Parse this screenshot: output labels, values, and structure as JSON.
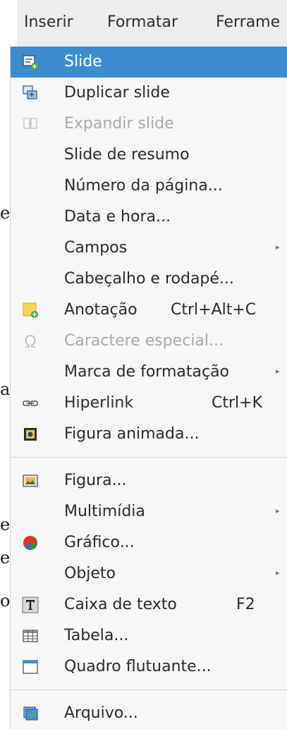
{
  "background_doc": {
    "chars": [
      "e",
      "a",
      "e",
      "e",
      "o"
    ]
  },
  "menubar": {
    "items": [
      "Inserir",
      "Formatar",
      "Ferrame"
    ]
  },
  "menu": {
    "items": [
      {
        "label": "Slide",
        "icon": "new-slide-icon",
        "highlighted": true
      },
      {
        "label": "Duplicar slide",
        "icon": "duplicate-slide-icon"
      },
      {
        "label": "Expandir slide",
        "icon": "expand-slide-icon",
        "disabled": true
      },
      {
        "label": "Slide de resumo"
      },
      {
        "label": "Número da página..."
      },
      {
        "label": "Data e hora..."
      },
      {
        "label": "Campos",
        "submenu": true
      },
      {
        "label": "Cabeçalho e rodapé..."
      },
      {
        "label": "Anotação",
        "accel": "Ctrl+Alt+C",
        "icon": "comment-icon"
      },
      {
        "label": "Caractere especial...",
        "icon": "omega-icon",
        "disabled": true
      },
      {
        "label": "Marca de formatação",
        "submenu": true
      },
      {
        "label": "Hiperlink",
        "accel": "Ctrl+K",
        "icon": "hyperlink-icon"
      },
      {
        "label": "Figura animada...",
        "icon": "animated-image-icon"
      },
      {
        "label": "Figura...",
        "icon": "image-icon"
      },
      {
        "label": "Multimídia",
        "submenu": true
      },
      {
        "label": "Gráfico...",
        "icon": "chart-icon"
      },
      {
        "label": "Objeto",
        "submenu": true
      },
      {
        "label": "Caixa de texto",
        "accel": "F2",
        "icon": "text-box-icon"
      },
      {
        "label": "Tabela...",
        "icon": "table-icon"
      },
      {
        "label": "Quadro flutuante...",
        "icon": "floating-frame-icon"
      },
      {
        "label": "Arquivo...",
        "icon": "file-icon"
      }
    ],
    "submenu_glyph": "▸"
  },
  "colors": {
    "highlight": "#3b8dd0",
    "disabled_text": "#a9a9a9"
  }
}
